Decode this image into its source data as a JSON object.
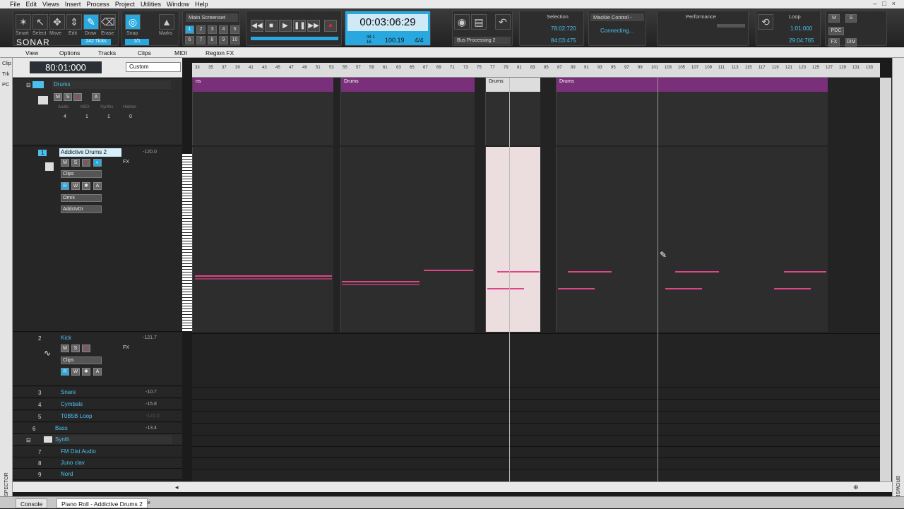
{
  "menu": [
    "File",
    "Edit",
    "Views",
    "Insert",
    "Process",
    "Project",
    "Utilities",
    "Window",
    "Help"
  ],
  "tools": {
    "labels": [
      "Smart",
      "Select",
      "Move",
      "Edit",
      "Draw",
      "Erase"
    ],
    "snap_label": "Snap",
    "marks_label": "Marks",
    "ticks": "242 Ticks",
    "ratio": "1/1",
    "logo": "SONAR"
  },
  "screenset": {
    "title": "Main Screenset",
    "buttons": [
      "1",
      "2",
      "3",
      "4",
      "5",
      "6",
      "7",
      "8",
      "9",
      "10"
    ]
  },
  "transport": {
    "time": "00:03:06:29",
    "tempo": "100.19",
    "meter": "4/4",
    "sr1": "44.1",
    "sr2": "16",
    "bus": "Bus Processing 2"
  },
  "selection": {
    "title": "Selection",
    "start": "78:02:720",
    "end": "84:03:475"
  },
  "mackie": {
    "title": "Mackie Control -",
    "status": "Connecting..."
  },
  "performance": {
    "title": "Performance"
  },
  "loop": {
    "title": "Loop",
    "start": "1:01:000",
    "end": "29:04:765"
  },
  "right_buttons": [
    "M",
    "S",
    "PDC",
    "FX",
    "DIM"
  ],
  "submenu": [
    "View",
    "Options",
    "Tracks",
    "Clips",
    "MIDI",
    "Region FX"
  ],
  "left_tabs": [
    "Clip",
    "Trk",
    "PC"
  ],
  "now_time": "80:01:000",
  "custom": "Custom",
  "folder_drums": {
    "name": "Drums",
    "cols": [
      "Audio",
      "MIDI",
      "Synths",
      "Hidden"
    ],
    "vals": [
      "4",
      "1",
      "1",
      "0"
    ]
  },
  "track1": {
    "num": "1",
    "name": "Addictive Drums 2",
    "vol": "-120.0",
    "fx": "FX",
    "clips": "Clips",
    "input": "Omni",
    "output": "AddctvDr"
  },
  "track2": {
    "num": "2",
    "name": "Kick",
    "vol": "-121.7",
    "fx": "FX",
    "clips": "Clips"
  },
  "tracks": [
    {
      "num": "3",
      "name": "Snare",
      "vol": "-10.7"
    },
    {
      "num": "4",
      "name": "Cymbals",
      "vol": "-15.8"
    },
    {
      "num": "5",
      "name": "T0B5B Loop",
      "vol": "-122.0"
    },
    {
      "num": "6",
      "name": "Bass",
      "vol": "-13.4"
    }
  ],
  "folder_synth": "Synth",
  "synth_tracks": [
    {
      "num": "7",
      "name": "FM Dist Audio"
    },
    {
      "num": "8",
      "name": "Juno clav"
    },
    {
      "num": "9",
      "name": "Nord"
    }
  ],
  "clip_label": "Drums",
  "clip_labels": [
    "ns",
    "Drums",
    "Drums",
    "Drums"
  ],
  "ruler_labels": [
    "33",
    "35",
    "37",
    "39",
    "41",
    "43",
    "45",
    "47",
    "49",
    "51",
    "53",
    "55",
    "57",
    "59",
    "61",
    "63",
    "65",
    "67",
    "69",
    "71",
    "73",
    "75",
    "77",
    "79",
    "81",
    "83",
    "85",
    "87",
    "89",
    "91",
    "93",
    "95",
    "97",
    "99",
    "101",
    "103",
    "105",
    "107",
    "109",
    "111",
    "113",
    "115",
    "117",
    "119",
    "121",
    "123",
    "125",
    "127",
    "129",
    "131",
    "133"
  ],
  "inspector_label": "INSPECTOR",
  "browser_label": "BROWSER",
  "tabs": [
    "Console",
    "Piano Roll - Addictive Drums 2"
  ],
  "mslabels": {
    "m": "M",
    "s": "S",
    "r": "R",
    "w": "W",
    "a": "A"
  }
}
